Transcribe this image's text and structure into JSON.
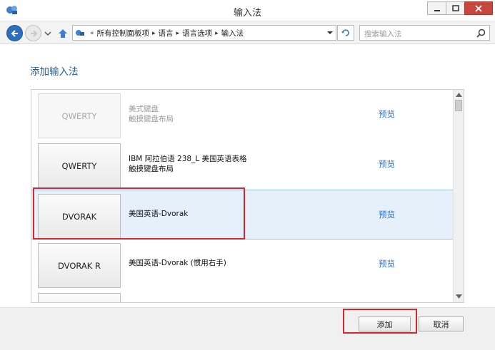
{
  "window": {
    "title": "输入法"
  },
  "address_bar": {
    "crumb_prefix": "«",
    "breadcrumbs": [
      "所有控制面板项",
      "语言",
      "语言选项",
      "输入法"
    ],
    "separator": "▸"
  },
  "search": {
    "placeholder": "搜索输入法"
  },
  "page": {
    "title": "添加输入法"
  },
  "layouts": [
    {
      "button": "QWERTY",
      "line1": "美式键盘",
      "line2": "触摸键盘布局",
      "preview": "预览",
      "enabled": false
    },
    {
      "button": "QWERTY",
      "line1": "IBM 阿拉伯语 238_L 美国英语表格",
      "line2": "触摸键盘布局",
      "preview": "预览",
      "enabled": true
    },
    {
      "button": "DVORAK",
      "line1": "美国英语-Dvorak",
      "line2": "",
      "preview": "预览",
      "enabled": true,
      "selected": true
    },
    {
      "button": "DVORAK R",
      "line1": "美国英语-Dvorak (惯用右手)",
      "line2": "",
      "preview": "预览",
      "enabled": true
    },
    {
      "button": "",
      "line1": "",
      "line2": "",
      "preview": "",
      "enabled": true
    }
  ],
  "buttons": {
    "add": "添加",
    "cancel": "取消"
  },
  "colors": {
    "link": "#2a6fc9",
    "title": "#1e5ba3",
    "highlight": "#d7262d",
    "selected_row": "#e5f0fb"
  }
}
